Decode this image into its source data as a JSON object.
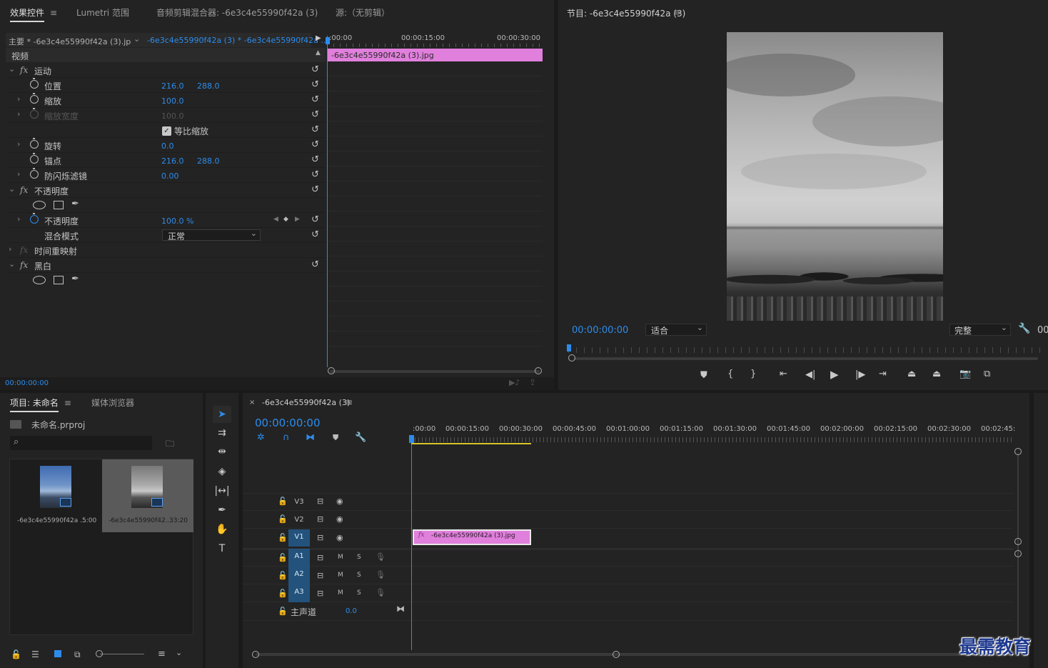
{
  "top_tabs": {
    "effect_controls": "效果控件",
    "lumetri": "Lumetri 范围",
    "audio_mixer": "音频剪辑混合器: -6e3c4e55990f42a (3)",
    "source": "源:（无剪辑）",
    "menu_glyph": "≡"
  },
  "effect_controls": {
    "master_clip": "主要 * -6e3c4e55990f42a (3).jpg",
    "sequence_clip": "-6e3c4e55990f42a (3) * -6e3c4e55990f42a ...",
    "mini_timeline": {
      "t0": ":00:00",
      "t1": "00:00:15:00",
      "t2": "00:00:30:00",
      "clip_name": "-6e3c4e55990f42a (3).jpg"
    },
    "video_header": "视频",
    "rows": {
      "motion": "运动",
      "position": "位置",
      "position_x": "216.0",
      "position_y": "288.0",
      "scale": "缩放",
      "scale_val": "100.0",
      "scale_width": "缩放宽度",
      "scale_width_val": "100.0",
      "uniform_scale": "等比缩放",
      "rotation": "旋转",
      "rotation_val": "0.0",
      "anchor": "锚点",
      "anchor_x": "216.0",
      "anchor_y": "288.0",
      "flicker": "防闪烁滤镜",
      "flicker_val": "0.00",
      "opacity_group": "不透明度",
      "opacity": "不透明度",
      "opacity_val": "100.0 %",
      "blend_mode": "混合模式",
      "blend_val": "正常",
      "time_remap": "时间重映射",
      "black_white": "黑白"
    },
    "fx_glyph": "fx",
    "timecode": "00:00:00:00"
  },
  "program": {
    "title": "节目: -6e3c4e55990f42a (3)",
    "timecode": "00:00:00:00",
    "fit": "适合",
    "quality": "完整",
    "right_timecode": "00"
  },
  "project": {
    "tab_project": "项目: 未命名",
    "tab_media": "媒体浏览器",
    "file": "未命名.prproj",
    "search_placeholder": "",
    "items": [
      {
        "name": "-6e3c4e55990f42a ...",
        "duration": "5:00"
      },
      {
        "name": "-6e3c4e55990f42...",
        "duration": "33:20"
      }
    ]
  },
  "timeline": {
    "tab": "-6e3c4e55990f42a (3)",
    "timecode": "00:00:00:00",
    "ruler": [
      ":00:00",
      "00:00:15:00",
      "00:00:30:00",
      "00:00:45:00",
      "00:01:00:00",
      "00:01:15:00",
      "00:01:30:00",
      "00:01:45:00",
      "00:02:00:00",
      "00:02:15:00",
      "00:02:30:00",
      "00:02:45:"
    ],
    "tracks": {
      "v3": "V3",
      "v2": "V2",
      "v1": "V1",
      "a1": "A1",
      "a2": "A2",
      "a3": "A3",
      "m": "M",
      "s": "S"
    },
    "master": "主声道",
    "master_val": "0.0",
    "clip_name": "-6e3c4e55990f42a (3).jpg",
    "clip_fx": "fx"
  },
  "watermark": "最需教育",
  "colors": {
    "accent_blue": "#2d8ceb",
    "clip_pink": "#e07fdc",
    "track_target": "#23537c",
    "work_area_yellow": "#d6c52a"
  }
}
